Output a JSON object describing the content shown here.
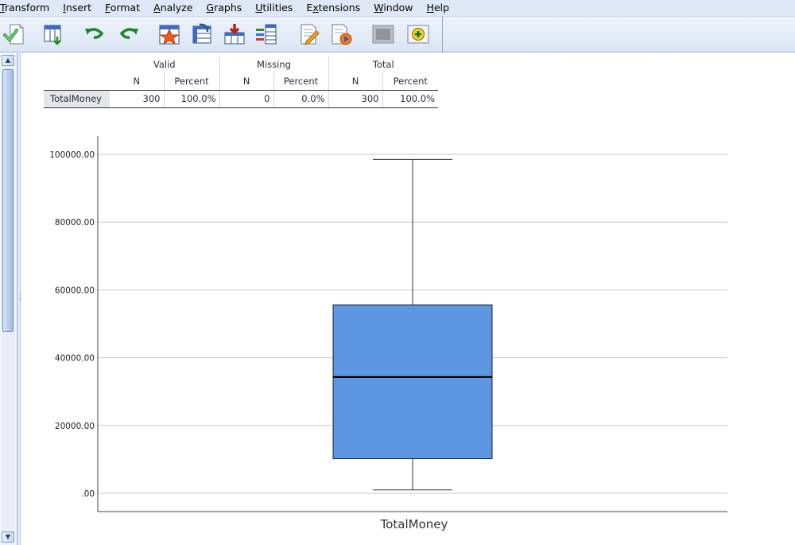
{
  "menubar": {
    "items": [
      {
        "label": "Transform",
        "mnemonic": "T",
        "rest": "ransform"
      },
      {
        "label": "Insert",
        "mnemonic": "I",
        "rest": "nsert"
      },
      {
        "label": "Format",
        "mnemonic": "F",
        "rest": "ormat"
      },
      {
        "label": "Analyze",
        "mnemonic": "A",
        "rest": "nalyze"
      },
      {
        "label": "Graphs",
        "mnemonic": "G",
        "rest": "raphs"
      },
      {
        "label": "Utilities",
        "mnemonic": "U",
        "rest": "tilities"
      },
      {
        "label": "Extensions",
        "mnemonic": "x",
        "pre": "E",
        "rest": "tensions"
      },
      {
        "label": "Window",
        "mnemonic": "W",
        "rest": "indow"
      },
      {
        "label": "Help",
        "mnemonic": "H",
        "rest": "elp"
      }
    ]
  },
  "toolbar": {
    "icons": [
      "export-icon",
      "goto-data-icon",
      "undo-icon",
      "redo-icon",
      "designated-window-icon",
      "goto-case-icon",
      "goto-variable-icon",
      "variables-icon",
      "edit-output-icon",
      "show-output-icon",
      "hide-output-icon",
      "insert-output-icon"
    ]
  },
  "case_table": {
    "groups": [
      "Valid",
      "Missing",
      "Total"
    ],
    "subheaders": [
      "N",
      "Percent",
      "N",
      "Percent",
      "N",
      "Percent"
    ],
    "rows": [
      {
        "label": "TotalMoney",
        "cells": [
          "300",
          "100.0%",
          "0",
          "0.0%",
          "300",
          "100.0%"
        ]
      }
    ]
  },
  "chart_data": {
    "type": "boxplot",
    "categories": [
      "TotalMoney"
    ],
    "xlabel": "TotalMoney",
    "ylim": [
      0,
      105000
    ],
    "y_ticks": [
      0,
      20000,
      40000,
      60000,
      80000,
      100000
    ],
    "y_tick_labels": [
      ".00",
      "20000.00",
      "40000.00",
      "60000.00",
      "80000.00",
      "100000.00"
    ],
    "grid": true,
    "series": [
      {
        "min": 1000,
        "q1": 10200,
        "median": 34300,
        "q3": 55600,
        "max": 98500
      }
    ],
    "box_color": "#5d97e2",
    "grid_color": "#c8c8c8"
  }
}
